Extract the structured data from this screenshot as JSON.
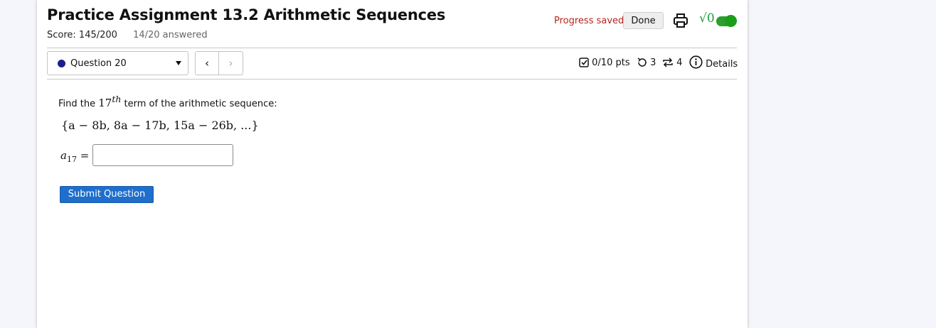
{
  "header": {
    "title": "Practice Assignment 13.2 Arithmetic Sequences",
    "score": "Score: 145/200",
    "answered": "14/20 answered",
    "progress_status": "Progress saved",
    "done_label": "Done",
    "math_toggle_label": "√0",
    "math_toggle_on": true
  },
  "question_nav": {
    "selected": "Question 20",
    "prev_label": "‹",
    "next_label": "›"
  },
  "question_meta": {
    "points": "0/10 pts",
    "attempts": "3",
    "versions": "4",
    "details_label": "Details"
  },
  "question": {
    "prompt_prefix": "Find the ",
    "term_number": "17",
    "term_suffix": "th",
    "prompt_suffix": " term of the arithmetic sequence:",
    "sequence": "{a − 8b, 8a − 17b, 15a − 26b, ...}",
    "answer_label_var": "a",
    "answer_label_sub": "17",
    "answer_label_eq": " =",
    "answer_value": "",
    "submit_label": "Submit Question"
  },
  "colors": {
    "saved_text": "#b3261e",
    "submit_bg": "#1f6ecc",
    "toggle_green": "#1a9d1a",
    "status_dot": "#1b1f8f"
  }
}
